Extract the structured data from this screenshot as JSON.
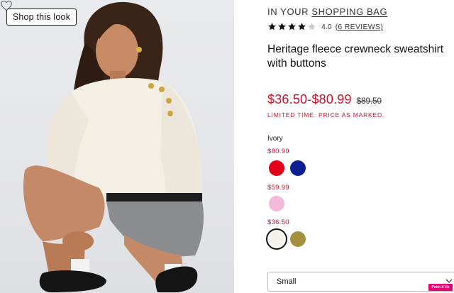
{
  "photo": {
    "shop_look_label": "Shop this look",
    "heart_icon": "heart-outline-icon"
  },
  "details": {
    "bag_prefix": "IN YOUR",
    "bag_link": "SHOPPING BAG",
    "rating": {
      "stars": 4.0,
      "max_stars": 5,
      "score": "4.0",
      "reviews": "(6 REVIEWS)"
    },
    "title_line1": "Heritage fleece crewneck sweatshirt",
    "title_line2": "with buttons",
    "price_range": "$36.50-$80.99",
    "original_price": "$89.50",
    "promo": "LIMITED TIME. PRICE AS MARKED.",
    "color_name": "Ivory",
    "price_tiers": [
      {
        "price": "$80.99",
        "swatches": [
          {
            "color": "#e00019",
            "name": "red"
          },
          {
            "color": "#0d1f91",
            "name": "navy"
          }
        ]
      },
      {
        "price": "$59.99",
        "swatches": [
          {
            "color": "#f2b8d8",
            "name": "pink"
          }
        ]
      },
      {
        "price": "$36.50",
        "swatches": [
          {
            "color": "#f4f2ea",
            "name": "ivory",
            "selected": true
          },
          {
            "color": "#a4913f",
            "name": "olive"
          }
        ]
      }
    ],
    "size_value": "Small",
    "pin_label": "Point X Ue"
  },
  "colors": {
    "sale_red": "#c8102e",
    "text": "#111111",
    "pin_pink": "#e60073"
  }
}
